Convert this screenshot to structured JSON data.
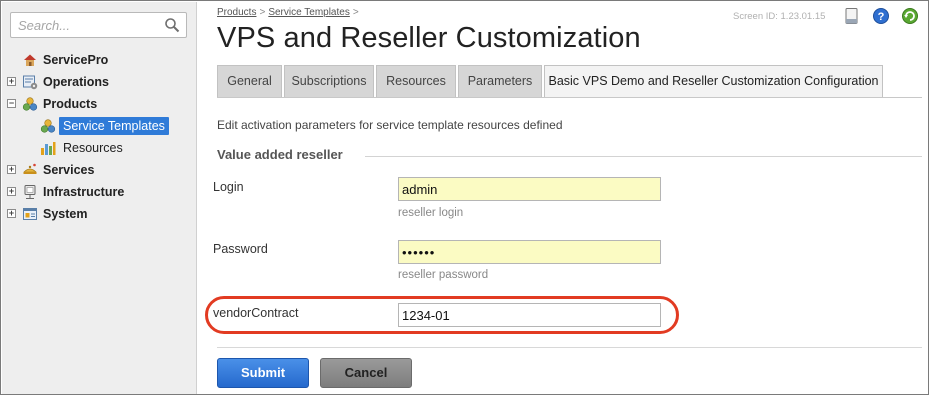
{
  "search": {
    "placeholder": "Search..."
  },
  "sidebar": {
    "items": [
      {
        "label": "ServicePro",
        "icon": "house-icon",
        "toggle": ""
      },
      {
        "label": "Operations",
        "icon": "operations-icon",
        "toggle": "+"
      },
      {
        "label": "Products",
        "icon": "products-icon",
        "toggle": "−"
      },
      {
        "label": "Service Templates",
        "icon": "service-templates-icon",
        "toggle": "",
        "selected": true
      },
      {
        "label": "Resources",
        "icon": "resources-icon",
        "toggle": ""
      },
      {
        "label": "Services",
        "icon": "services-icon",
        "toggle": "+"
      },
      {
        "label": "Infrastructure",
        "icon": "infrastructure-icon",
        "toggle": "+"
      },
      {
        "label": "System",
        "icon": "system-icon",
        "toggle": "+"
      }
    ]
  },
  "breadcrumb": {
    "items": [
      "Products",
      "Service Templates"
    ],
    "sep": ">"
  },
  "header": {
    "screen_id": "Screen ID:  1.23.01.15",
    "title": "VPS and Reseller Customization"
  },
  "tabs": [
    {
      "label": "General"
    },
    {
      "label": "Subscriptions"
    },
    {
      "label": "Resources"
    },
    {
      "label": "Parameters"
    },
    {
      "label": "Basic VPS Demo and Reseller Customization Configuration",
      "active": true
    }
  ],
  "form": {
    "description": "Edit activation parameters for service template resources defined",
    "section_title": "Value added reseller",
    "login": {
      "label": "Login",
      "value": "admin",
      "hint": "reseller login"
    },
    "password": {
      "label": "Password",
      "value": "••••••",
      "hint": "reseller password"
    },
    "vendor_contract": {
      "label": "vendorContract",
      "value": "1234-01"
    }
  },
  "buttons": {
    "submit": "Submit",
    "cancel": "Cancel"
  },
  "colors": {
    "accent": "#2f7bd8",
    "highlight": "#e23b22",
    "input_yellow": "#fbfbc3"
  }
}
